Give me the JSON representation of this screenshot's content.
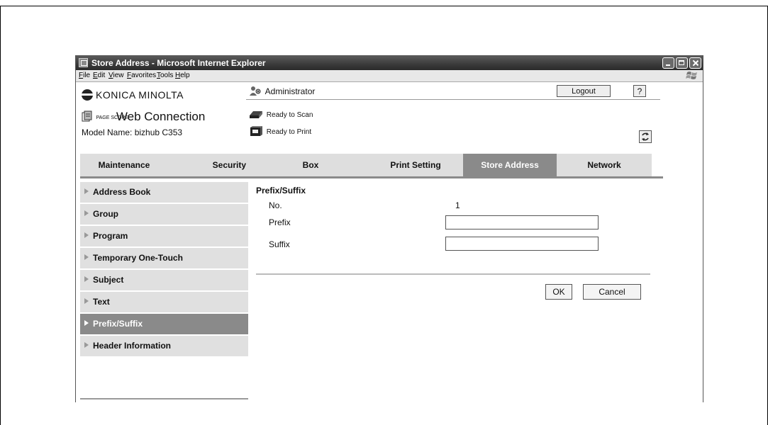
{
  "window": {
    "title": "Store Address - Microsoft Internet Explorer",
    "menu": [
      "File",
      "Edit",
      "View",
      "Favorites",
      "Tools",
      "Help"
    ]
  },
  "header": {
    "brand": "KONICA MINOLTA",
    "product_prefix": "PAGE SCOPE",
    "product": "Web Connection",
    "model_label": "Model Name: bizhub C353",
    "user": "Administrator",
    "logout_label": "Logout",
    "help_label": "?",
    "scan_status": "Ready to Scan",
    "print_status": "Ready to Print"
  },
  "tabs": [
    {
      "label": "Maintenance",
      "active": false
    },
    {
      "label": "Security",
      "active": false
    },
    {
      "label": "Box",
      "active": false
    },
    {
      "label": "Print Setting",
      "active": false
    },
    {
      "label": "Store Address",
      "active": true
    },
    {
      "label": "Network",
      "active": false
    }
  ],
  "sidebar": {
    "items": [
      {
        "label": "Address Book",
        "active": false
      },
      {
        "label": "Group",
        "active": false
      },
      {
        "label": "Program",
        "active": false
      },
      {
        "label": "Temporary One-Touch",
        "active": false
      },
      {
        "label": "Subject",
        "active": false
      },
      {
        "label": "Text",
        "active": false
      },
      {
        "label": "Prefix/Suffix",
        "active": true
      },
      {
        "label": "Header Information",
        "active": false
      }
    ]
  },
  "form": {
    "title": "Prefix/Suffix",
    "no_label": "No.",
    "no_value": "1",
    "prefix_label": "Prefix",
    "prefix_value": "",
    "suffix_label": "Suffix",
    "suffix_value": "",
    "ok_label": "OK",
    "cancel_label": "Cancel"
  },
  "colors": {
    "active_tab": "#8a8a8a",
    "inactive_tab": "#dedede",
    "titlebar": "#3a3a3a"
  }
}
